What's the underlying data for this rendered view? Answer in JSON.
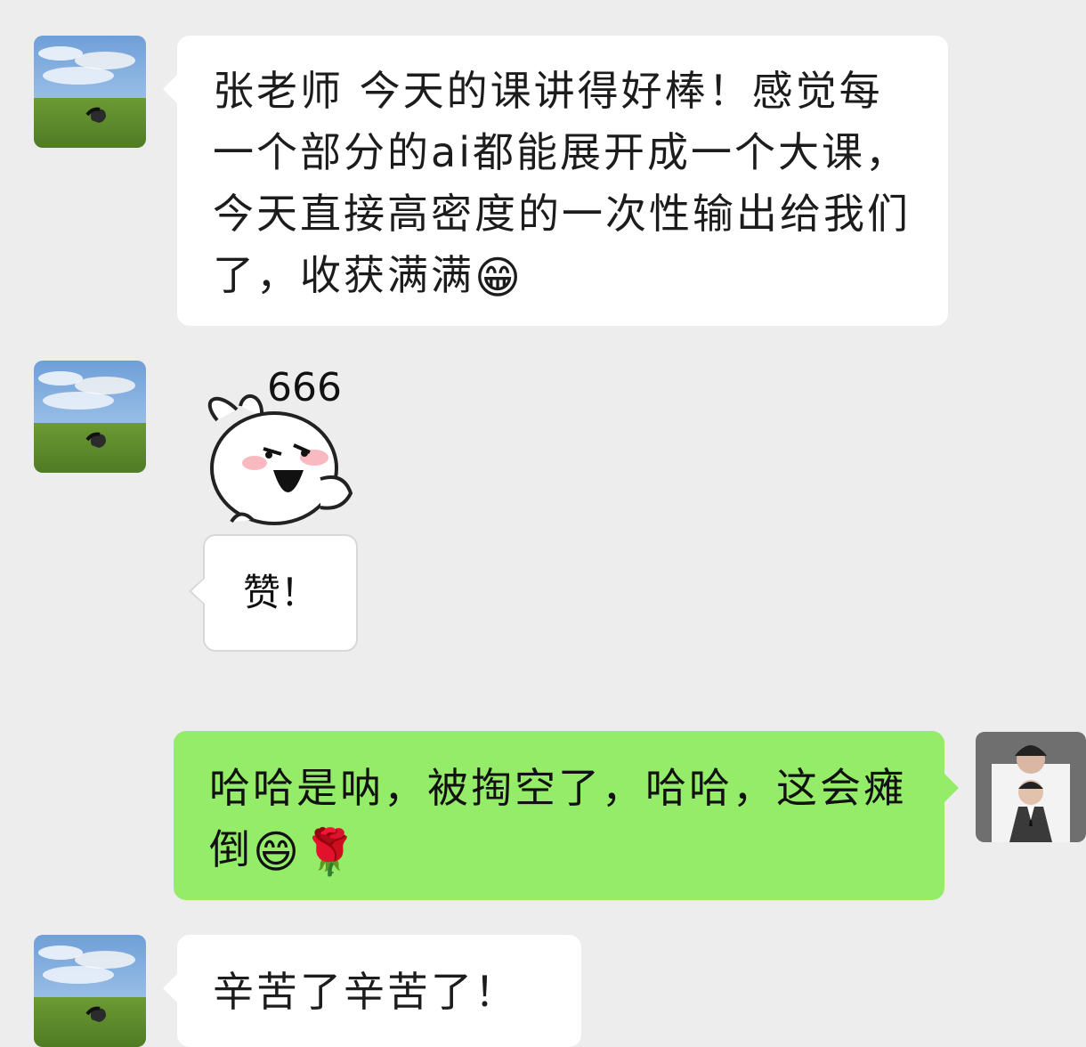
{
  "messages": [
    {
      "from": "other",
      "text": "张老师 今天的课讲得好棒！感觉每一个部分的ai都能展开成一个大课，今天直接高密度的一次性输出给我们了，收获满满",
      "emoji": "😁"
    },
    {
      "from": "other",
      "sticker": {
        "number_text": "666",
        "label": "赞！"
      }
    },
    {
      "from": "me",
      "text": "哈哈是呐，被掏空了，哈哈，这会瘫倒",
      "emoji": "😄🌹"
    },
    {
      "from": "other",
      "text": "辛苦了辛苦了！"
    }
  ],
  "colors": {
    "background": "#ededed",
    "incoming_bubble": "#ffffff",
    "outgoing_bubble": "#95ec69"
  },
  "icons": {
    "other_avatar": "landscape-avatar",
    "me_avatar": "portrait-avatar",
    "sticker": "rabbit-666-sticker"
  }
}
